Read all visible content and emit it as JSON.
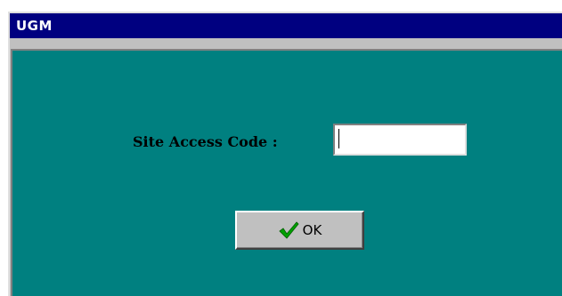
{
  "window": {
    "title": "UGM"
  },
  "form": {
    "site_access_code_label": "Site Access Code :",
    "site_access_code_value": "",
    "ok_label": "OK"
  },
  "icons": {
    "ok_icon": "check-icon"
  },
  "colors": {
    "title_bar": "#000080",
    "panel": "#008080",
    "check": "#00a000"
  }
}
